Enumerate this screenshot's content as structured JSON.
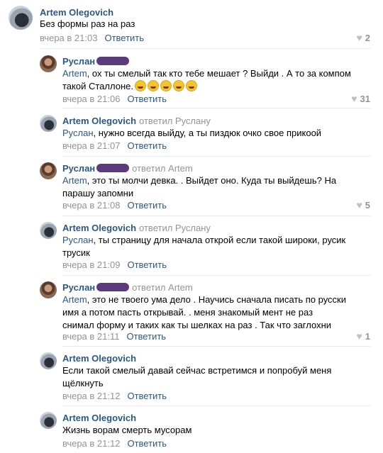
{
  "comments": [
    {
      "author": "Artem Olegovich",
      "replied_to": "",
      "text_mention": "",
      "text": "Без формы раз на раз",
      "time": "вчера в 21:03",
      "reply": "Ответить",
      "likes": "2"
    },
    {
      "author": "Руслан",
      "replied_to": "",
      "text_mention": "Artem",
      "text": ", ох ты смелый так кто тебе мешает ? Выйди . А то за компом такой Сталлоне.",
      "time": "вчера в 21:06",
      "reply": "Ответить",
      "likes": "31"
    },
    {
      "author": "Artem Olegovich",
      "replied_to": "ответил Руслану",
      "text_mention": "Руслан",
      "text": ", нужно всегда выйду, а ты пиздюк очко свое прикоой",
      "time": "вчера в 21:07",
      "reply": "Ответить",
      "likes": ""
    },
    {
      "author": "Руслан",
      "replied_to": "ответил Artem",
      "text_mention": "Artem",
      "text": ", это ты молчи девка. . Выйдет оно. Куда ты выйдешь? На парашу запомни",
      "time": "вчера в 21:08",
      "reply": "Ответить",
      "likes": "5"
    },
    {
      "author": "Artem Olegovich",
      "replied_to": "ответил Руслану",
      "text_mention": "Руслан",
      "text": ", ты страницу для начала открой если такой широки, русик трусик",
      "time": "вчера в 21:09",
      "reply": "Ответить",
      "likes": ""
    },
    {
      "author": "Руслан",
      "replied_to": "ответил Artem",
      "text_mention": "Artem",
      "text": ", это не твоего ума дело . Научись сначала писать по русски имя а потом пасть открывай. . меня знакомый мент не раз снимал форму и таких как ты шелках на раз . Так что заглохни",
      "time": "вчера в 21:11",
      "reply": "Ответить",
      "likes": "1"
    },
    {
      "author": "Artem Olegovich",
      "replied_to": "",
      "text_mention": "",
      "text": "Если такой смелый давай сейчас встретимся и попробуй меня щёлкнуть",
      "time": "вчера в 21:12",
      "reply": "Ответить",
      "likes": ""
    },
    {
      "author": "Artem Olegovich",
      "replied_to": "",
      "text_mention": "",
      "text": "Жизнь ворам смерть мусорам",
      "time": "вчера в 21:12",
      "reply": "Ответить",
      "likes": ""
    }
  ]
}
